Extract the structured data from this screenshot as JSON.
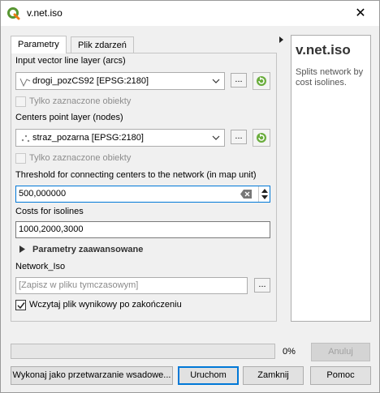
{
  "window": {
    "title": "v.net.iso",
    "close_label": "✕"
  },
  "tabs": [
    {
      "label": "Parametry",
      "active": true
    },
    {
      "label": "Plik zdarzeń",
      "active": false
    }
  ],
  "params": {
    "input_layer_label": "Input vector line layer (arcs)",
    "input_layer_value": "drogi_pozCS92 [EPSG:2180]",
    "selected_only_1": "Tylko zaznaczone obiekty",
    "centers_label": "Centers point layer (nodes)",
    "centers_value": "straz_pozarna [EPSG:2180]",
    "selected_only_2": "Tylko zaznaczone obiekty",
    "threshold_label": "Threshold for connecting centers to the network (in map unit)",
    "threshold_value": "500,000000",
    "costs_label": "Costs for isolines",
    "costs_value": "1000,2000,3000",
    "advanced_label": "Parametry zaawansowane",
    "output_label": "Network_Iso",
    "output_placeholder": "[Zapisz w pliku tymczasowym]",
    "open_output_label": "Wczytaj plik wynikowy po zakończeniu",
    "open_output_checked": true,
    "browse_label": "...",
    "browse_label_2": "...",
    "browse_label_3": "..."
  },
  "help": {
    "title": "v.net.iso",
    "description": "Splits network by cost isolines."
  },
  "progress": {
    "value_percent": 0,
    "label": "0%"
  },
  "buttons": {
    "cancel": "Anuluj",
    "batch": "Wykonaj jako przetwarzanie wsadowe...",
    "run": "Uruchom",
    "close": "Zamknij",
    "help": "Pomoc"
  },
  "colors": {
    "accent": "#0078d7",
    "qgis_green": "#589632",
    "qgis_yellow": "#ee7913"
  }
}
